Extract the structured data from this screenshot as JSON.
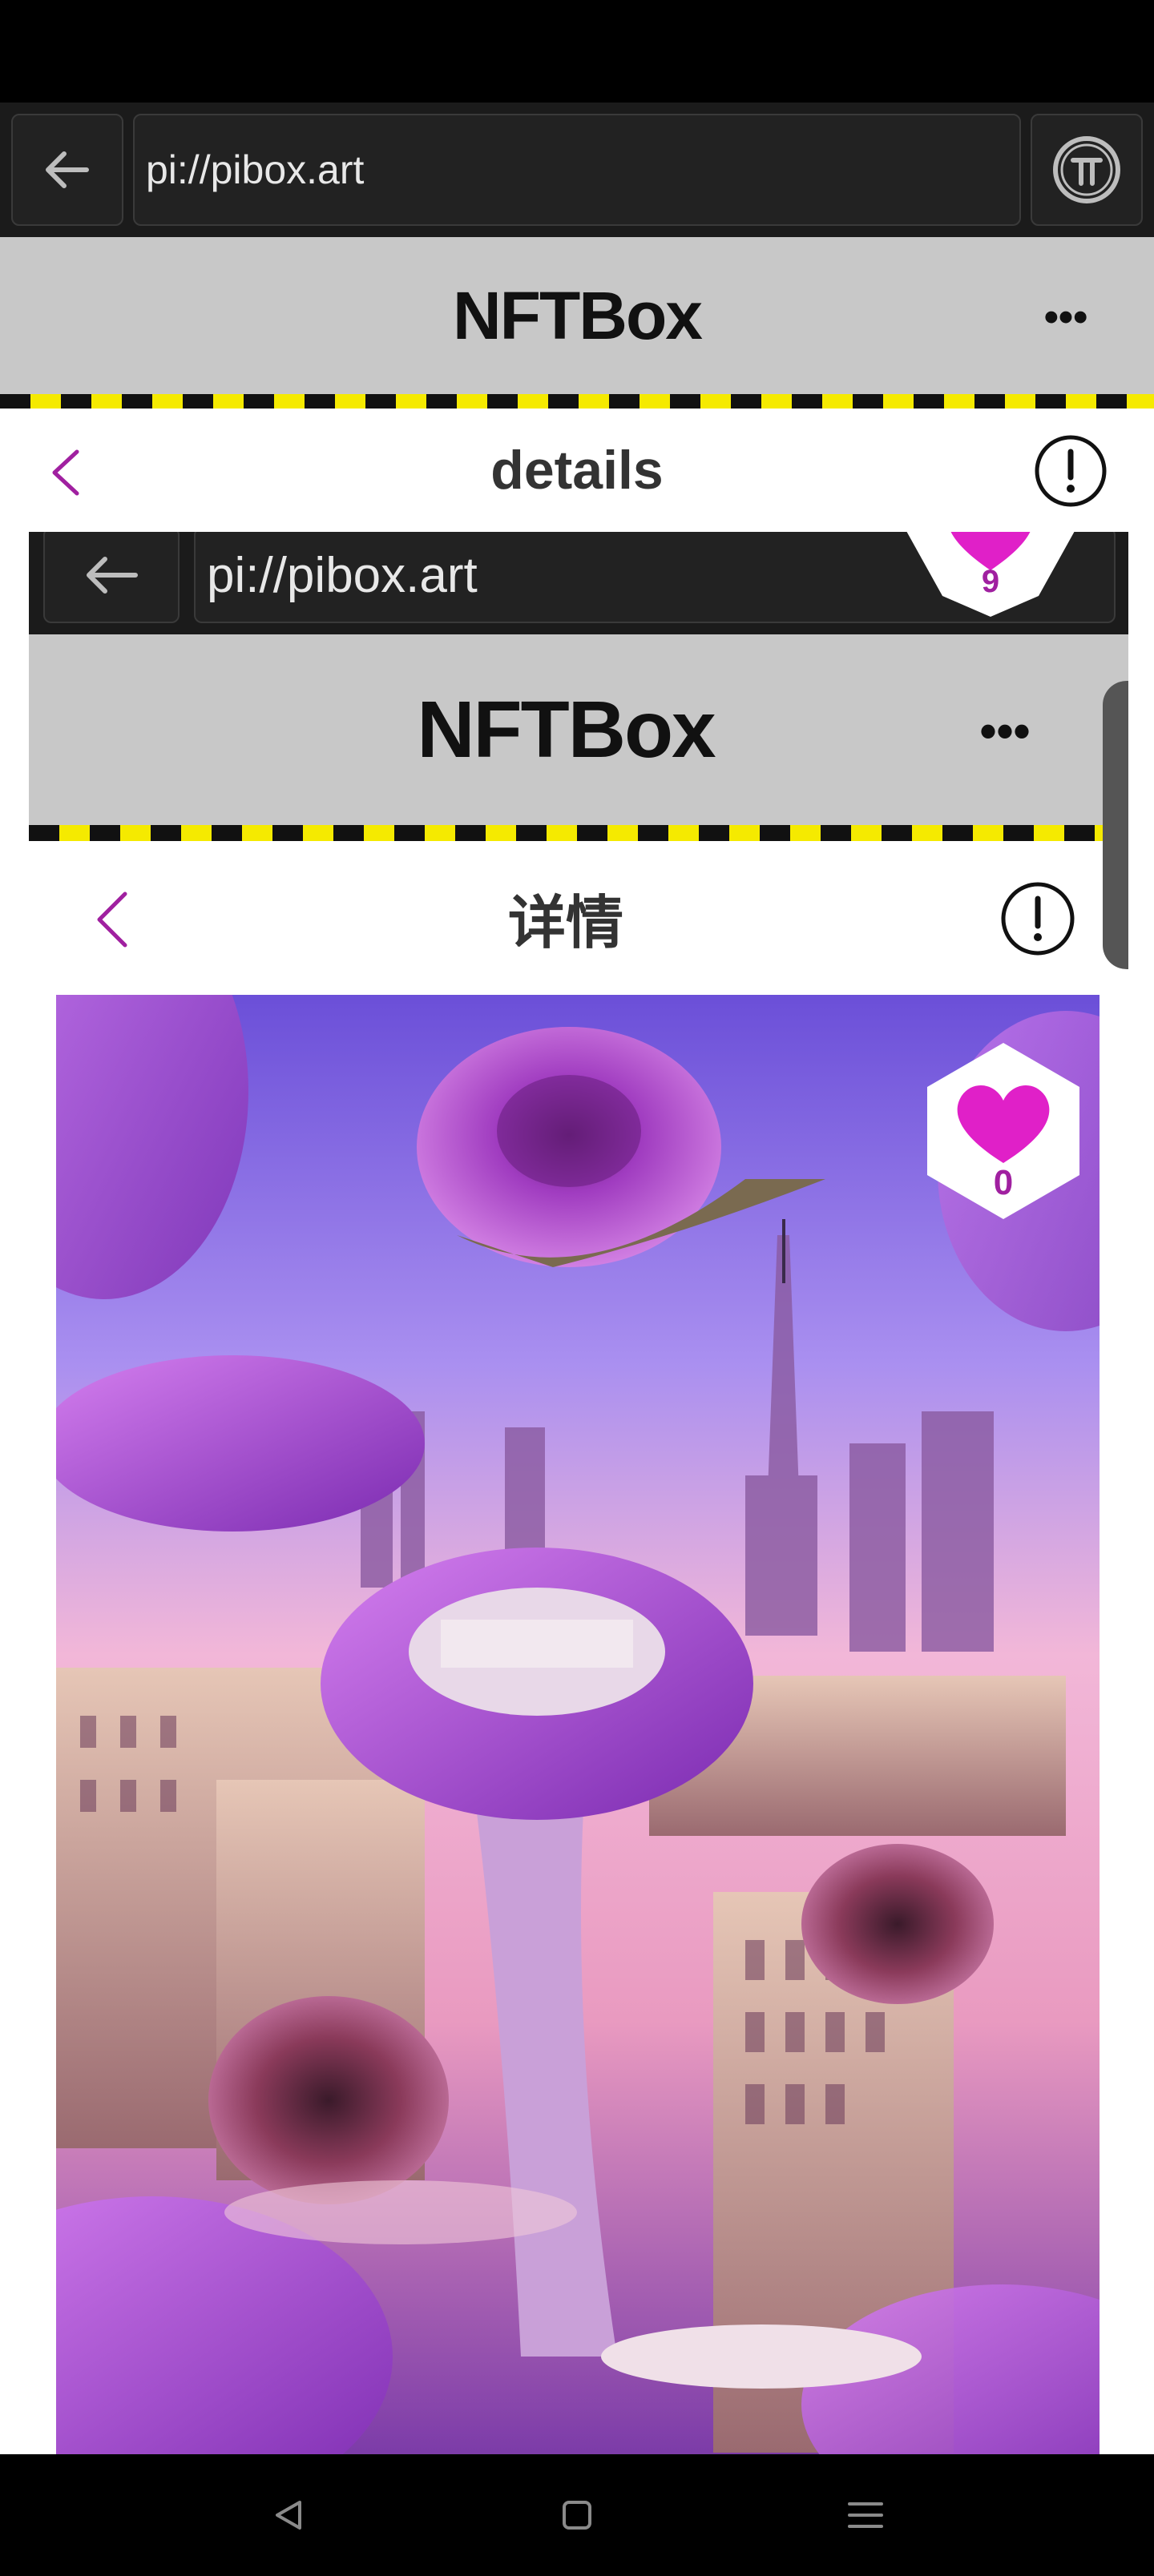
{
  "browser": {
    "url": "pi://pibox.art"
  },
  "app": {
    "title": "NFTBox",
    "more": "•••"
  },
  "page": {
    "title": "details"
  },
  "embedded": {
    "url": "pi://pibox.art",
    "app_title": "NFTBox",
    "more": "•••",
    "page_title": "详情",
    "top_like_count": "9",
    "art_like_count": "0"
  },
  "colors": {
    "accent_purple": "#a020a0",
    "like_magenta": "#e020c8",
    "hazard_yellow": "#f5ea00",
    "header_gray": "#c8c8c8"
  },
  "icons": {
    "nav_back": "arrow-left-icon",
    "pi_logo": "pi-icon",
    "page_back": "chevron-left-icon",
    "info": "exclamation-circle-icon",
    "like": "heart-icon",
    "sys_back": "triangle-back-icon",
    "sys_home": "square-home-icon",
    "sys_menu": "menu-lines-icon"
  }
}
